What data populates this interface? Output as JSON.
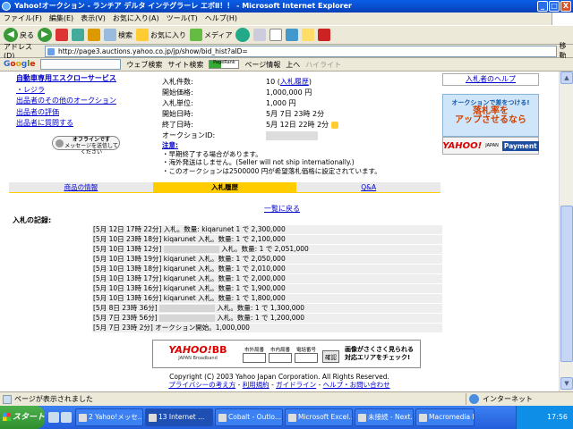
{
  "window": {
    "title": "Yahoo!オークション - ランチア デルタ インテグラーレ エボⅡ！！ - Microsoft Internet Explorer",
    "min": "_",
    "max": "□",
    "close": "X"
  },
  "menu": [
    "ファイル(F)",
    "編集(E)",
    "表示(V)",
    "お気に入り(A)",
    "ツール(T)",
    "ヘルプ(H)"
  ],
  "toolbar": {
    "back": "戻る",
    "search": "検索",
    "favorites": "お気に入り",
    "media": "メディア"
  },
  "address": {
    "label": "アドレス(D)",
    "url": "http://page3.auctions.yahoo.co.jp/jp/show/bid_hist?aID=",
    "go": "移動"
  },
  "googlebar": {
    "logo": [
      "G",
      "o",
      "o",
      "g",
      "l",
      "e"
    ],
    "web_search": "ウェブ検索",
    "site_search": "サイト検索",
    "pagerank": "PageRank",
    "page_info": "ページ情報",
    "up": "上へ",
    "highlight": "ハイライト"
  },
  "left_links": {
    "title": "自動車専用エスクローサービス",
    "items": [
      "・レジラ",
      "出品者のその他のオークション",
      "出品者の評価",
      "出品者に質問する"
    ]
  },
  "offline": {
    "line1": "オフラインです",
    "line2": "メッセージを送信してください"
  },
  "info": {
    "rows": [
      {
        "label": "入札件数:",
        "value": "10",
        "link": "入札履歴"
      },
      {
        "label": "開始価格:",
        "value": "1,000,000 円"
      },
      {
        "label": "入札単位:",
        "value": "1,000 円"
      },
      {
        "label": "開始日時:",
        "value": "5月 7日 23時 2分"
      },
      {
        "label": "終了日時:",
        "value": "5月 12日 22時 2分"
      },
      {
        "label": "オークションID:",
        "value": ""
      }
    ]
  },
  "notes": {
    "head": "注意:",
    "lines": [
      "・早期終了する場合があります。",
      "・海外発送はしません。(Seller will not ship internationally.)",
      "・このオークションは2500000 円が希望落札価格に設定されています。"
    ]
  },
  "right": {
    "help": "入札者のヘルプ",
    "banner_line1": "オークションで差をつける!",
    "banner_big1": "落札率を",
    "banner_big2": "アップさせるなら",
    "yahoo": "YAHOO!",
    "japan": "JAPAN",
    "payment": "Payment"
  },
  "tabs": [
    "商品の情報",
    "入札履歴",
    "Q&A"
  ],
  "back_link": "一覧に戻る",
  "bid_heading": "入札の記録:",
  "bids": [
    {
      "date": "[5月 12日 17時 22分]",
      "text": "入札。数量: kiqarunet 1 で 2,300,000"
    },
    {
      "date": "[5月 10日 23時 18分]",
      "text": "kiqarunet 入札。数量: 1 で 2,100,000"
    },
    {
      "date": "[5月 10日 13時 12分]",
      "text": "入札。数量: 1 で 2,051,000",
      "blank": true
    },
    {
      "date": "[5月 10日 13時 19分]",
      "text": "kiqarunet 入札。数量: 1 で 2,050,000"
    },
    {
      "date": "[5月 10日 13時 18分]",
      "text": "kiqarunet 入札。数量: 1 で 2,010,000"
    },
    {
      "date": "[5月 10日 13時 17分]",
      "text": "kiqarunet 入札。数量: 1 で 2,000,000"
    },
    {
      "date": "[5月 10日 13時 16分]",
      "text": "kiqarunet 入札。数量: 1 で 1,900,000"
    },
    {
      "date": "[5月 10日 13時 16分]",
      "text": "kiqarunet 入札。数量: 1 で 1,800,000"
    },
    {
      "date": "[5月 8日 23時 36分]",
      "text": "入札。数量: 1 で 1,300,000",
      "blank": true
    },
    {
      "date": "[5月 7日 23時 56分]",
      "text": "入札。数量: 1 で 1,200,000",
      "blank": true
    },
    {
      "date": "[5月 7日 23時 2分]",
      "text": "オークション開始。1,000,000"
    }
  ],
  "bb_banner": {
    "yahoo": "YAHOO!",
    "bb": "BB",
    "sub": "JAPAN Broadband",
    "field1": "市外局番",
    "field2": "市内局番",
    "field3": "電話番号",
    "confirm": "確認",
    "desc1": "画像がさくさく見られる",
    "desc2": "対応エリアをチェック!"
  },
  "footer": {
    "copyright": "Copyright (C) 2003 Yahoo Japan Corporation. All Rights Reserved.",
    "links": [
      "プライバシーの考え方",
      "利用規約",
      "ガイドライン",
      "ヘルプ・お問い合わせ"
    ]
  },
  "status": {
    "text": "ページが表示されました",
    "zone": "インターネット"
  },
  "taskbar": {
    "start": "スタート",
    "tasks": [
      "2 Yahoo!メッセ...",
      "13 Internet ...",
      "Cobalt - Outlo...",
      "Microsoft Excel...",
      "未接続 - Next...",
      "Macromedia Fir..."
    ],
    "clock": "17:56"
  }
}
